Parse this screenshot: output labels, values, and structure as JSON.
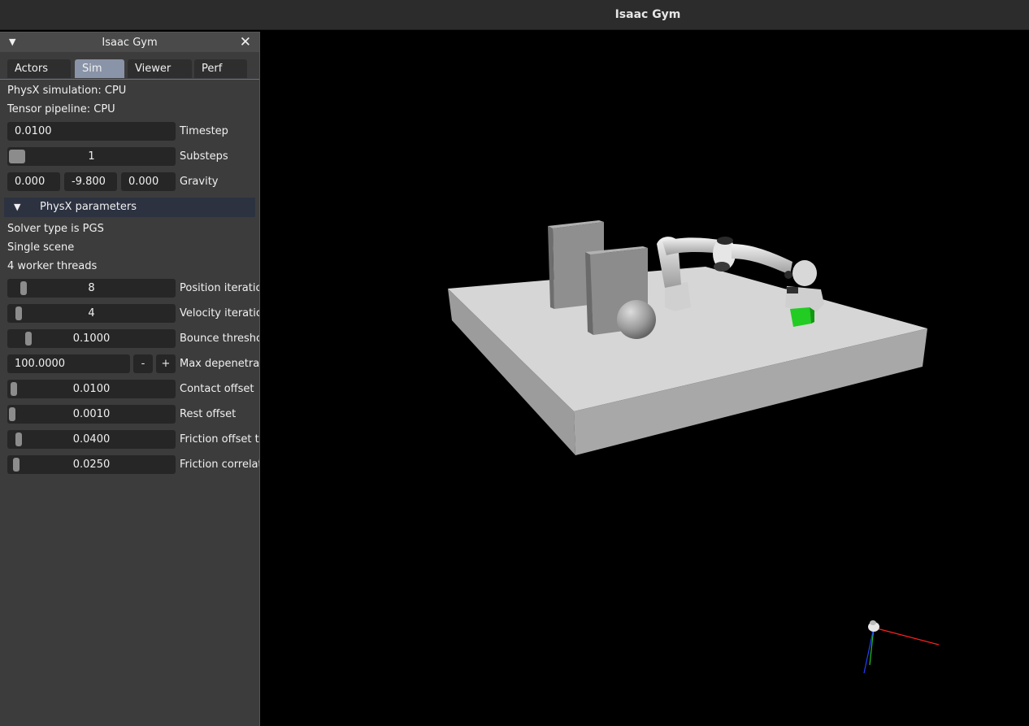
{
  "app": {
    "title": "Isaac Gym"
  },
  "panel": {
    "title": "Isaac Gym",
    "tabs": [
      {
        "label": "Actors",
        "active": false
      },
      {
        "label": "Sim",
        "active": true
      },
      {
        "label": "Viewer",
        "active": false
      },
      {
        "label": "Perf",
        "active": false
      }
    ],
    "info": {
      "physx": "PhysX simulation: CPU",
      "tensor": "Tensor pipeline: CPU"
    },
    "timestep": {
      "value": "0.0100",
      "label": "Timestep"
    },
    "substeps": {
      "value": "1",
      "label": "Substeps"
    },
    "gravity": {
      "x": "0.000",
      "y": "-9.800",
      "z": "0.000",
      "label": "Gravity"
    },
    "physx_section": {
      "title": "PhysX parameters",
      "solver": "Solver type is PGS",
      "scene": "Single scene",
      "threads": "4 worker threads",
      "position_iterations": {
        "value": "8",
        "label": "Position iteratio"
      },
      "velocity_iterations": {
        "value": "4",
        "label": "Velocity iteratio"
      },
      "bounce_threshold": {
        "value": "0.1000",
        "label": "Bounce thresho"
      },
      "max_depenetration": {
        "value": "100.0000",
        "label": "Max depenetrat",
        "minus": "-",
        "plus": "+"
      },
      "contact_offset": {
        "value": "0.0100",
        "label": "Contact offset"
      },
      "rest_offset": {
        "value": "0.0010",
        "label": "Rest offset"
      },
      "friction_offset": {
        "value": "0.0400",
        "label": "Friction offset t"
      },
      "friction_correlation": {
        "value": "0.0250",
        "label": "Friction correlat"
      }
    }
  },
  "icons": {
    "collapse": "triangle-down-icon",
    "close": "close-icon",
    "section_arrow": "triangle-down-icon"
  },
  "colors": {
    "active_tab": "#8a94a8",
    "section_bg": "#2c3240",
    "axis_x": "#ff2020",
    "axis_y": "#20c020",
    "axis_z": "#2040ff",
    "cube": "#22cc22"
  }
}
